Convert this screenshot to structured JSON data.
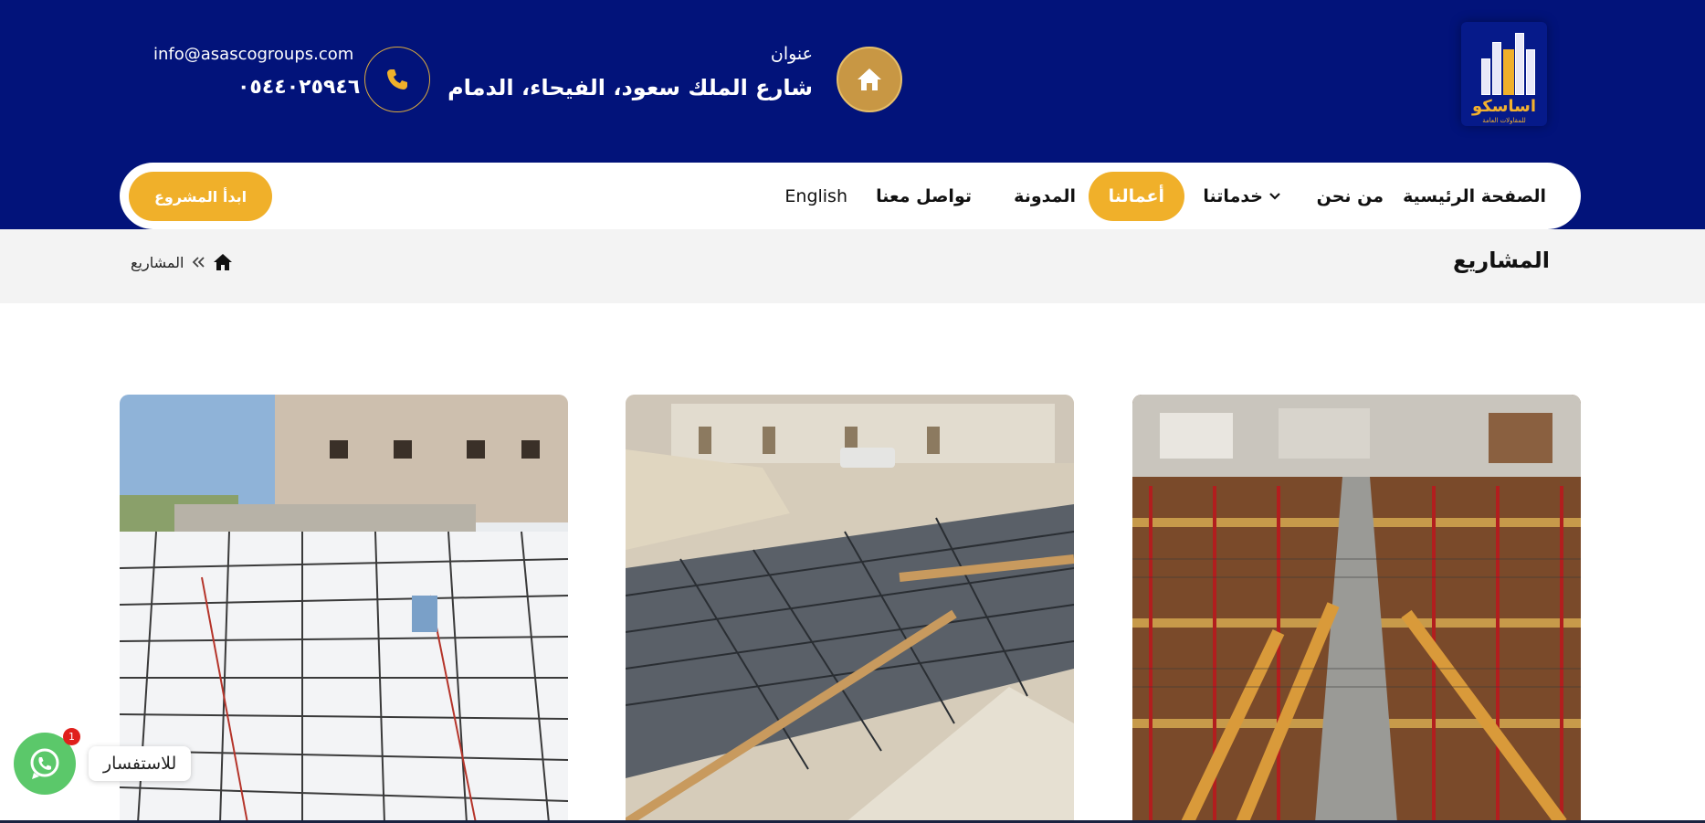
{
  "colors": {
    "brand_blue": "#02137a",
    "accent_gold": "#f0b02a",
    "breadcrumb_bg": "#f3f3f3",
    "whatsapp_green": "#5bc86a"
  },
  "header": {
    "logo_text": "اساسكو",
    "logo_subtext": "للمقاولات العامة",
    "address_label": "عنوان",
    "address_value": "شارع الملك سعود، الفيحاء، الدمام",
    "email": "info@asascogroups.com",
    "phone": "٠٥٤٤٠٢٥٩٤٦",
    "icons": [
      "home-icon",
      "phone-icon"
    ]
  },
  "nav": {
    "items": [
      {
        "label": "الصفحة الرئيسية"
      },
      {
        "label": "من نحن"
      },
      {
        "label": "خدماتنا"
      },
      {
        "label": "أعمالنا",
        "active": true
      },
      {
        "label": "المدونة"
      },
      {
        "label": "تواصل معنا"
      },
      {
        "label": "English"
      }
    ],
    "cta_label": "ابدأ المشروع"
  },
  "breadcrumb": {
    "title": "المشاريع",
    "current": "المشاريع"
  },
  "gallery": {
    "items": [
      {
        "alt": "project-photo-formwork"
      },
      {
        "alt": "project-photo-foundation-rebar"
      },
      {
        "alt": "project-photo-slab-rebar"
      }
    ]
  },
  "chat": {
    "label": "للاستفسار",
    "badge": "1"
  }
}
